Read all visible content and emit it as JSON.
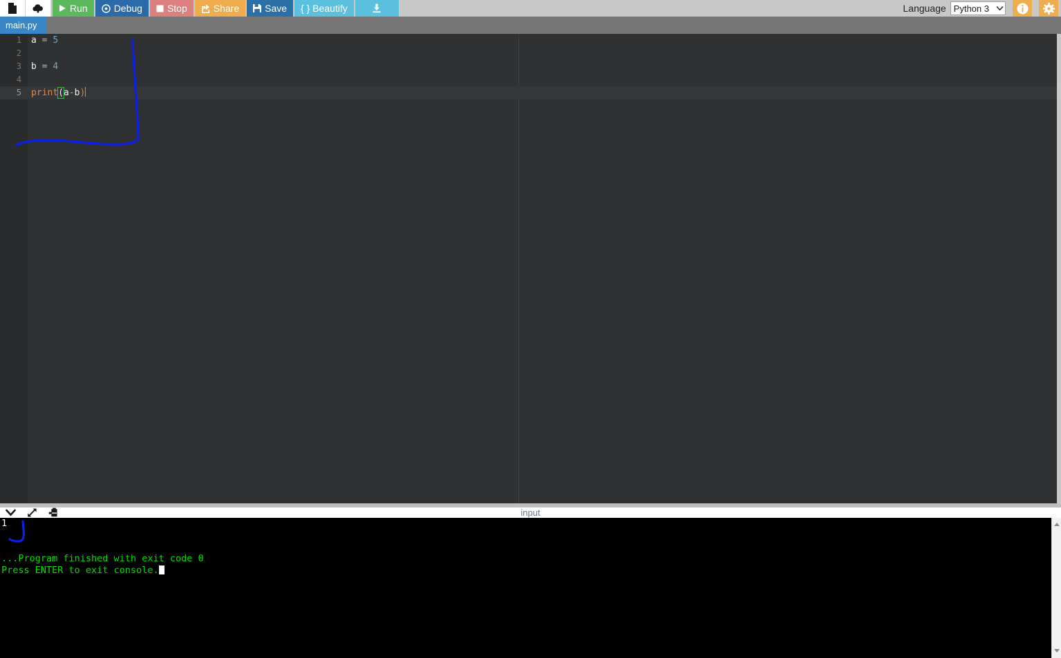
{
  "toolbar": {
    "new_file_icon": "document-icon",
    "upload_icon": "upload-cloud-icon",
    "run_label": "Run",
    "debug_label": "Debug",
    "stop_label": "Stop",
    "share_label": "Share",
    "save_label": "Save",
    "beautify_label": "{ } Beautify",
    "download_icon": "download-icon",
    "language_label": "Language",
    "language_value": "Python 3",
    "info_icon": "info-icon",
    "settings_icon": "gear-icon",
    "colors": {
      "run": "#5cb85c",
      "debug": "#2a6aa8",
      "stop": "#dd8080",
      "share": "#f0ad4e",
      "save": "#2a6fa8",
      "beautify": "#5bc0de",
      "download": "#5bc0de",
      "accent_orange": "#f0ad4e",
      "toolbar_bg": "#c8c8c8"
    }
  },
  "tabs": {
    "active": "main.py",
    "items": [
      {
        "label": "main.py"
      }
    ]
  },
  "editor": {
    "line_numbers": [
      "1",
      "2",
      "3",
      "4",
      "5"
    ],
    "active_line": 5,
    "lines": [
      {
        "n": "1",
        "a": "a",
        "op": " = ",
        "val": "5"
      },
      {
        "n": "2",
        "a": "",
        "op": "",
        "val": ""
      },
      {
        "n": "3",
        "a": "b",
        "op": " = ",
        "val": "4"
      },
      {
        "n": "4",
        "a": "",
        "op": "",
        "val": ""
      },
      {
        "n": "5",
        "a": "",
        "op": "",
        "val": ""
      }
    ],
    "line5": {
      "fn": "print",
      "open_paren": "(",
      "arg_left": "a",
      "operator": "-",
      "arg_right": "b",
      "close_paren": ")"
    },
    "colors": {
      "background": "#303133",
      "gutter": "#2a2b2c",
      "active_line": "#343637",
      "keyword": "#e08a4a",
      "number": "#6fa8c8",
      "text": "#f2f2f2",
      "bracket_match": "#4caf50"
    }
  },
  "annotations": {
    "ink_color": "#0d1fe0",
    "strokes": [
      {
        "name": "editor-ink-stroke"
      },
      {
        "name": "console-ink-stroke"
      }
    ]
  },
  "console_header": {
    "collapse_icon": "chevron-down-icon",
    "expand_icon": "expand-arrows-icon",
    "copy_icon": "clipboard-copy-icon",
    "input_label": "input"
  },
  "console": {
    "output_value": "1",
    "finished_line": "...Program finished with exit code 0",
    "prompt_line": "Press ENTER to exit console.",
    "colors": {
      "background": "#000000",
      "output": "#ffffff",
      "status": "#00e000"
    }
  },
  "scrollbar": {
    "up_icon": "scroll-up-arrow-icon",
    "down_icon": "scroll-down-arrow-icon"
  }
}
